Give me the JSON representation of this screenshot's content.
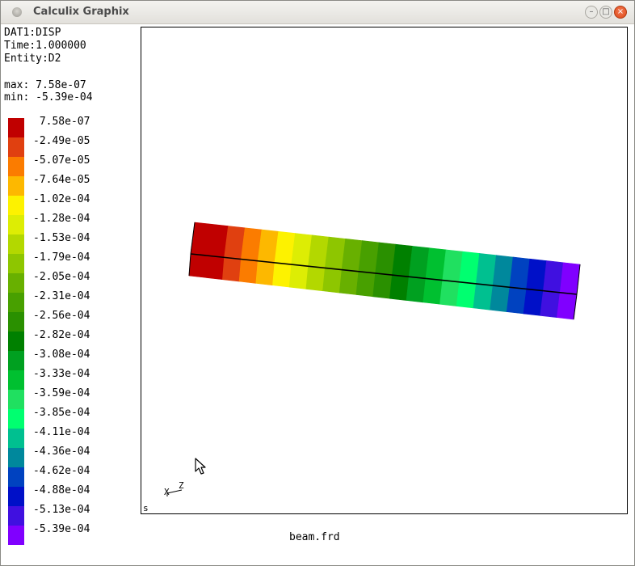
{
  "window": {
    "title": "Calculix Graphix",
    "minimize": "–",
    "maximize": "□",
    "close": "×"
  },
  "info": {
    "dataset": "DAT1:DISP",
    "time": "Time:1.000000",
    "entity": "Entity:D2",
    "max": "max: 7.58e-07",
    "min": "min: -5.39e-04"
  },
  "legend": [
    {
      "label": " 7.58e-07",
      "color": "#c00000"
    },
    {
      "label": "-2.49e-05",
      "color": "#e04010"
    },
    {
      "label": "-5.07e-05",
      "color": "#fb7c00"
    },
    {
      "label": "-7.64e-05",
      "color": "#fdb800"
    },
    {
      "label": "-1.02e-04",
      "color": "#fdf200"
    },
    {
      "label": "-1.28e-04",
      "color": "#dded04"
    },
    {
      "label": "-1.53e-04",
      "color": "#b3d800"
    },
    {
      "label": "-1.79e-04",
      "color": "#8ec600"
    },
    {
      "label": "-2.05e-04",
      "color": "#68b000"
    },
    {
      "label": "-2.31e-04",
      "color": "#48a000"
    },
    {
      "label": "-2.56e-04",
      "color": "#2a9000"
    },
    {
      "label": "-2.82e-04",
      "color": "#008000"
    },
    {
      "label": "-3.08e-04",
      "color": "#00a020"
    },
    {
      "label": "-3.33e-04",
      "color": "#00c030"
    },
    {
      "label": "-3.59e-04",
      "color": "#20e060"
    },
    {
      "label": "-3.85e-04",
      "color": "#00ff70"
    },
    {
      "label": "-4.11e-04",
      "color": "#00c090"
    },
    {
      "label": "-4.36e-04",
      "color": "#00889c"
    },
    {
      "label": "-4.62e-04",
      "color": "#0042c0"
    },
    {
      "label": "-4.88e-04",
      "color": "#0010c8"
    },
    {
      "label": "-5.13e-04",
      "color": "#4010e0"
    },
    {
      "label": "-5.39e-04",
      "color": "#8000ff"
    }
  ],
  "viewport": {
    "axis_x": "X",
    "axis_z": "Z",
    "corner_label": "s"
  },
  "filename": "beam.frd",
  "icons": {
    "cursor": "arrow-cursor-icon",
    "axes": "axis-triad-icon"
  }
}
